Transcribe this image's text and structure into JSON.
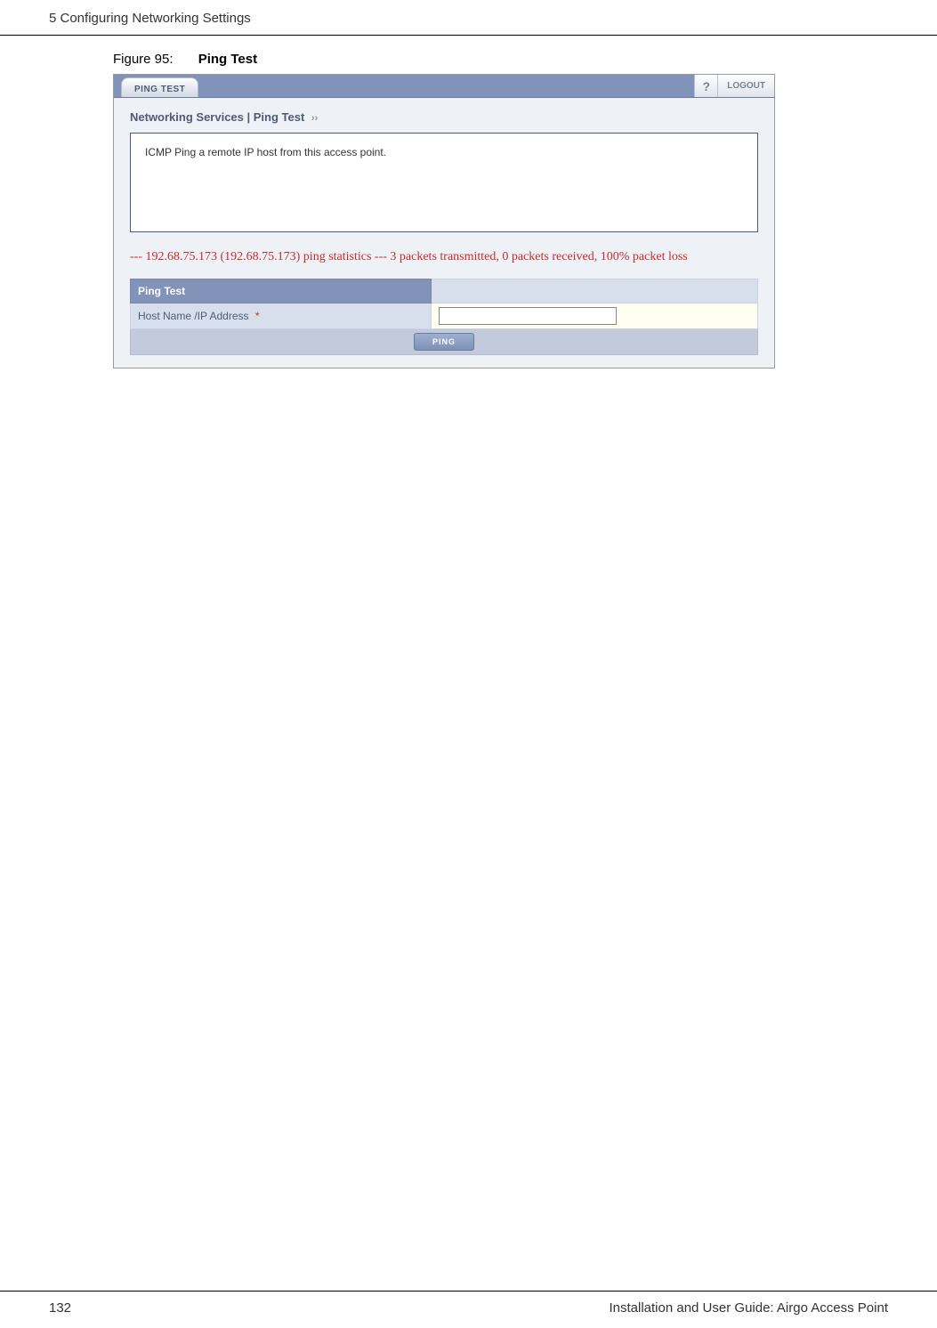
{
  "header": {
    "chapter": "5  Configuring Networking Settings"
  },
  "figure": {
    "label": "Figure 95:",
    "title": "Ping Test"
  },
  "ui": {
    "tab": "PING TEST",
    "help": "?",
    "logout": "LOGOUT",
    "breadcrumb": "Networking Services | Ping Test",
    "breadcrumb_suffix": "››",
    "description": "ICMP Ping a remote IP host from this access point.",
    "status": "--- 192.68.75.173 (192.68.75.173) ping statistics --- 3 packets transmitted, 0 packets received, 100% packet loss",
    "form": {
      "section_title": "Ping Test",
      "field_label": "Host Name /IP Address",
      "required": "*",
      "value": "",
      "button": "PING"
    }
  },
  "footer": {
    "page_number": "132",
    "doc_title": "Installation and User Guide: Airgo Access Point"
  }
}
